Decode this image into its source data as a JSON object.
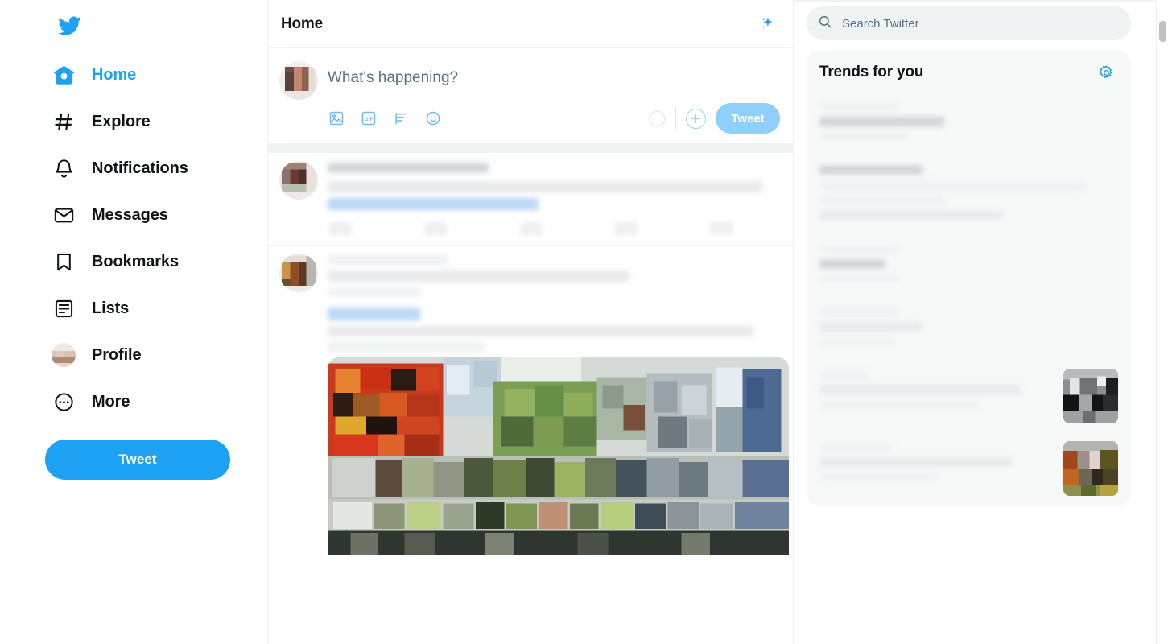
{
  "sidebar": {
    "logo": "twitter-bird-logo",
    "items": [
      {
        "label": "Home",
        "icon": "home-icon",
        "active": true
      },
      {
        "label": "Explore",
        "icon": "hashtag-icon",
        "active": false
      },
      {
        "label": "Notifications",
        "icon": "bell-icon",
        "active": false
      },
      {
        "label": "Messages",
        "icon": "envelope-icon",
        "active": false
      },
      {
        "label": "Bookmarks",
        "icon": "bookmark-icon",
        "active": false
      },
      {
        "label": "Lists",
        "icon": "list-icon",
        "active": false
      },
      {
        "label": "Profile",
        "icon": "profile-avatar-icon",
        "active": false
      },
      {
        "label": "More",
        "icon": "more-ellipsis-icon",
        "active": false
      }
    ],
    "tweet_button_label": "Tweet"
  },
  "header": {
    "title": "Home",
    "sparkle_icon": "sparkle-icon"
  },
  "compose": {
    "placeholder": "What's happening?",
    "avatar": "user-avatar-pixelated",
    "icons": [
      {
        "name": "image-icon",
        "label": "Media"
      },
      {
        "name": "gif-icon",
        "label": "GIF"
      },
      {
        "name": "poll-icon",
        "label": "Poll"
      },
      {
        "name": "emoji-icon",
        "label": "Emoji"
      }
    ],
    "char_counter": "character-count-circle",
    "add_button": "add-tweet-icon",
    "tweet_button_label": "Tweet",
    "tweet_button_disabled": true
  },
  "timeline": {
    "tweets": [
      {
        "id": "tweet-1",
        "avatar": "avatar-pixelated-brown",
        "redacted": true,
        "has_link": true,
        "has_image": false,
        "action_count": 5
      },
      {
        "id": "tweet-2",
        "avatar": "avatar-pixelated-orange",
        "redacted": true,
        "has_link": true,
        "has_image": true,
        "action_count": 0
      }
    ]
  },
  "search": {
    "placeholder": "Search Twitter",
    "value": "",
    "icon": "search-icon"
  },
  "trends": {
    "title": "Trends for you",
    "settings_icon": "gear-icon",
    "items": [
      {
        "id": "trend-1",
        "has_thumb": false
      },
      {
        "id": "trend-2",
        "has_thumb": false
      },
      {
        "id": "trend-3",
        "has_thumb": false
      },
      {
        "id": "trend-4",
        "has_thumb": true
      },
      {
        "id": "trend-5",
        "has_thumb": false
      },
      {
        "id": "trend-6",
        "has_thumb": true
      }
    ]
  },
  "colors": {
    "brand_blue": "#1DA1F2",
    "brand_blue_disabled": "#8ED0F9",
    "text_primary": "#0F1419",
    "text_secondary": "#5B7083",
    "border": "#EFF3F4",
    "panel_bg": "#F7F9F9",
    "search_bg": "#EFF3F4"
  },
  "scrollbar": {
    "name": "page-scrollbar",
    "position": "top"
  }
}
